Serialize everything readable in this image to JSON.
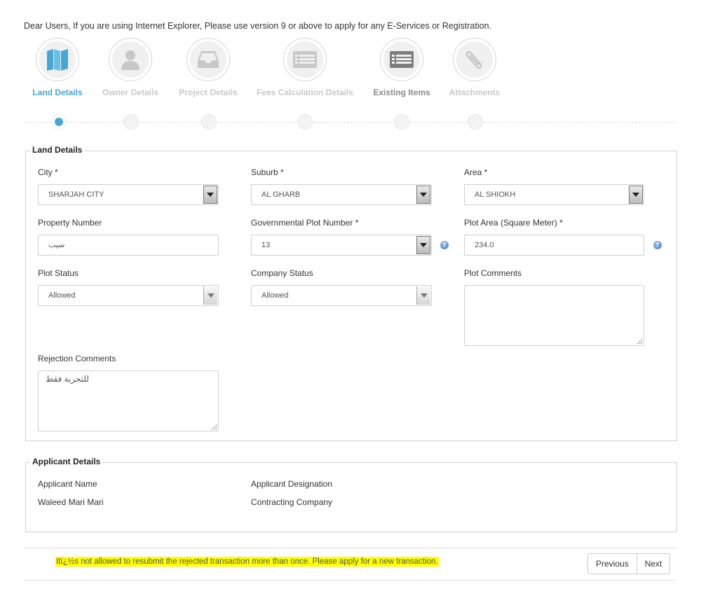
{
  "notice": "Dear Users, If you are using Internet Explorer, Please use version 9 or above to apply for any E-Services or Registration.",
  "wizard": {
    "steps": [
      {
        "label": "Land Details",
        "icon": "map-icon",
        "state": "active"
      },
      {
        "label": "Owner Details",
        "icon": "user-icon",
        "state": "inactive"
      },
      {
        "label": "Project Details",
        "icon": "inbox-tray-icon",
        "state": "inactive"
      },
      {
        "label": "Fees Calculation Details",
        "icon": "list-document-icon",
        "state": "inactive"
      },
      {
        "label": "Existing Items",
        "icon": "list-document-icon",
        "state": "dark"
      },
      {
        "label": "Attachments",
        "icon": "paperclip-icon",
        "state": "inactive"
      }
    ],
    "accent_color": "#47a7d4"
  },
  "land_details": {
    "legend": "Land Details",
    "city": {
      "label": "City *",
      "value": "SHARJAH CITY"
    },
    "suburb": {
      "label": "Suburb *",
      "value": "AL GHARB"
    },
    "area": {
      "label": "Area *",
      "value": "AL SHIOKH"
    },
    "property_number": {
      "label": "Property Number",
      "value": "سيب"
    },
    "gov_plot_number": {
      "label": "Governmental Plot Number *",
      "value": "13"
    },
    "plot_area": {
      "label": "Plot Area (Square Meter) *",
      "value": "234.0"
    },
    "plot_status": {
      "label": "Plot Status",
      "value": "Allowed"
    },
    "company_status": {
      "label": "Company Status",
      "value": "Allowed"
    },
    "plot_comments": {
      "label": "Plot Comments",
      "value": ""
    },
    "rejection_comments": {
      "label": "Rejection Comments",
      "value": "للتجربة فقط"
    }
  },
  "applicant_details": {
    "legend": "Applicant Details",
    "name_label": "Applicant Name",
    "name_value": "Waleed Mari Mari",
    "designation_label": "Applicant Designation",
    "designation_value": "Contracting Company"
  },
  "footer": {
    "warning": "Itï¿½s not allowed to resubmit the rejected transaction more than once. Please apply for a new transaction.",
    "warning_color": "#ffff00",
    "previous_label": "Previous",
    "next_label": "Next"
  }
}
